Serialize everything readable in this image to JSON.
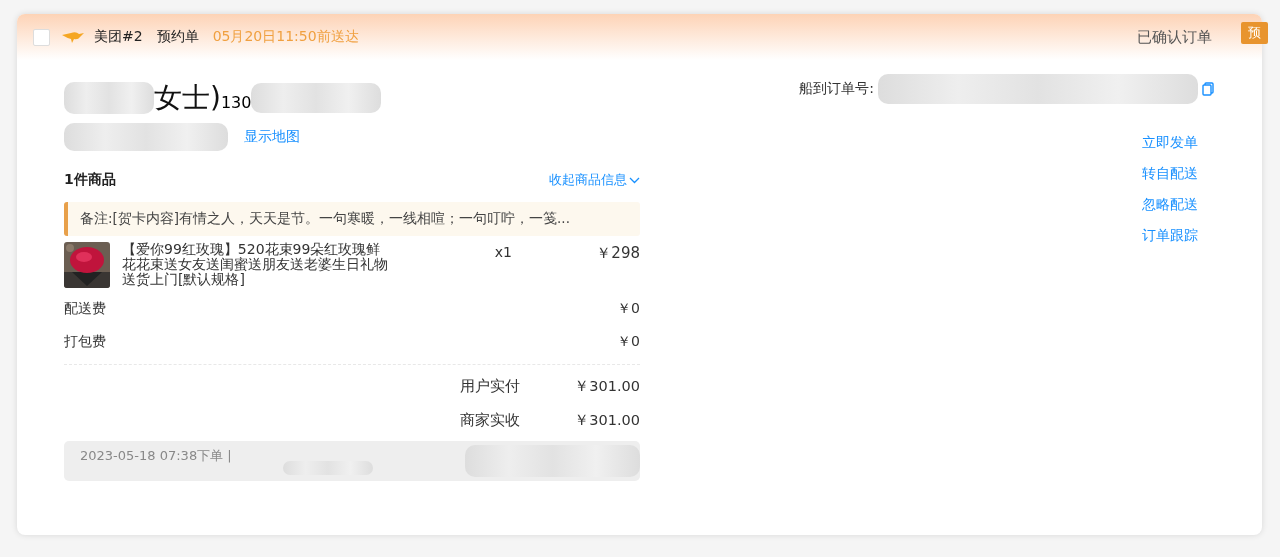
{
  "header": {
    "checked": false,
    "platform": "美团#2",
    "order_type": "预约单",
    "deadline": "05月20日11:50前送达",
    "status": "已确认订单",
    "badge": "预"
  },
  "customer": {
    "name_suffix": "女士)",
    "phone_prefix": "130",
    "map_link": "显示地图"
  },
  "order_number_label": "船到订单号:",
  "actions": [
    "立即发单",
    "转自配送",
    "忽略配送",
    "订单跟踪"
  ],
  "goods": {
    "count": "1件商品",
    "collapse_link": "收起商品信息",
    "note": "备注:[贺卡内容]有情之人，天天是节。一句寒暖，一线相喧；一句叮咛，一笺...",
    "items": [
      {
        "kind": "picture",
        "name": "【爱你99红玫瑰】520花束99朵红玫瑰鲜花花束送女友送闺蜜送朋友送老婆生日礼物送货上门[默认规格]",
        "qty": "x1",
        "price": "￥298"
      }
    ]
  },
  "fees": [
    {
      "label": "配送费",
      "value": "￥0"
    },
    {
      "label": "打包费",
      "value": "￥0"
    }
  ],
  "totals": [
    {
      "label": "用户实付",
      "value": "￥301.00"
    },
    {
      "label": "商家实收",
      "value": "￥301.00"
    }
  ],
  "footer": {
    "placed": "2023-05-18 07:38下单 |"
  }
}
